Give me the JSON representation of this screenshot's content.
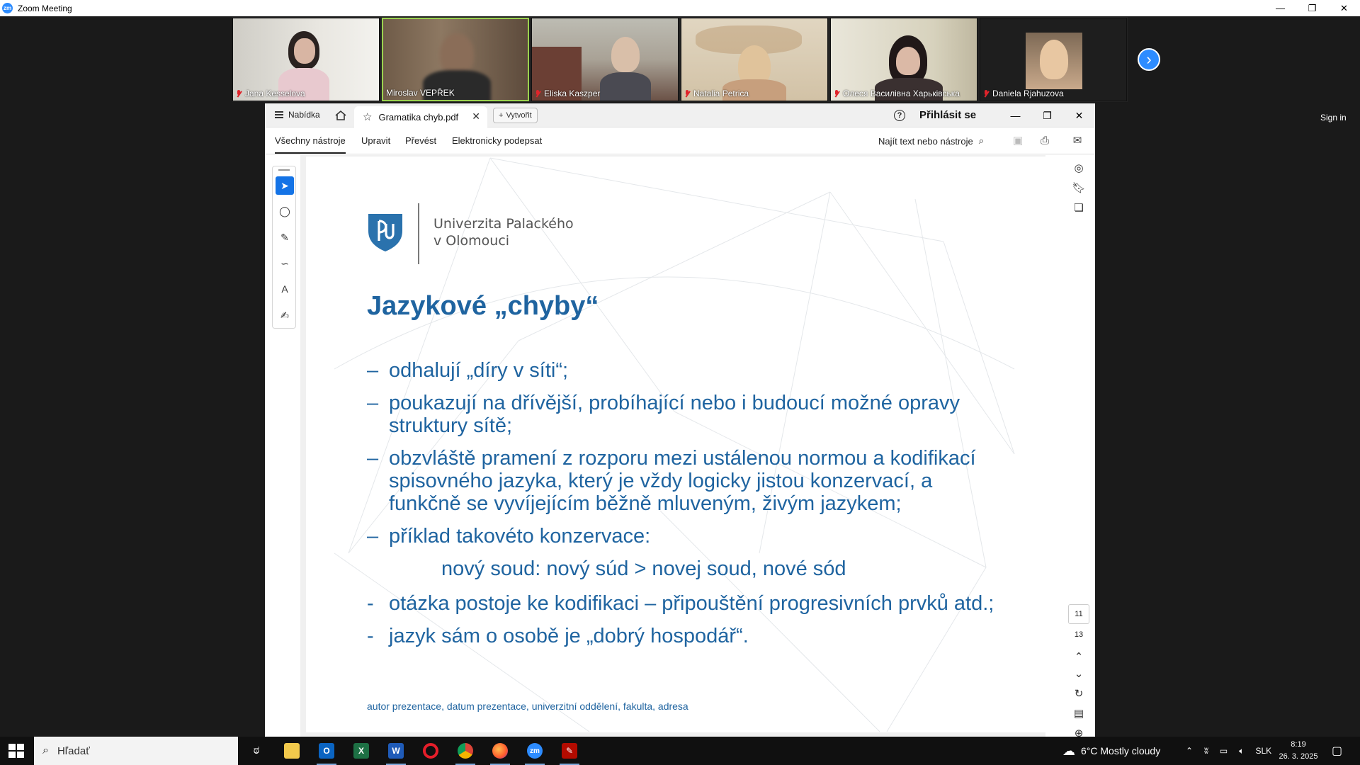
{
  "zoom": {
    "title": "Zoom Meeting",
    "sign_in": "Sign in",
    "participants": [
      {
        "name": "Jana Kesselova",
        "muted": true,
        "bg": "#d9d6cf"
      },
      {
        "name": "Miroslav VEPŘEK",
        "muted": false,
        "bg": "#6c5a48"
      },
      {
        "name": "Eliska Kaszper",
        "muted": true,
        "bg": "#b9b8ad"
      },
      {
        "name": "Natalia Petrica",
        "muted": true,
        "bg": "#d7c8ae"
      },
      {
        "name": "Олеся Василівна Харьківська",
        "muted": true,
        "bg": "#cfcab8"
      },
      {
        "name": "Daniela Rjahuzova",
        "muted": true,
        "bg": "#1e1e1e"
      }
    ]
  },
  "acrobat": {
    "menu_label": "Nabídka",
    "tab_title": "Gramatika chyb.pdf",
    "create_label": "Vytvořit",
    "sign_in_label": "Přihlásit se",
    "toolbar_tabs": [
      "Všechny nástroje",
      "Upravit",
      "Převést",
      "Elektronicky podepsat"
    ],
    "search_tools": "Najít text nebo nástroje",
    "current_page": "11",
    "total_pages": "13"
  },
  "slide": {
    "university_line1": "Univerzita Palackého",
    "university_line2": "v Olomouci",
    "title": "Jazykové „chyby“",
    "bullets": [
      {
        "dash": "–",
        "text": "odhalují „díry v síti“;"
      },
      {
        "dash": "–",
        "text": "poukazují na dřívější, probíhající nebo i budoucí možné opravy struktury sítě;"
      },
      {
        "dash": "–",
        "text": "obzvláště pramení z rozporu mezi ustálenou normou a kodifikací spisovného jazyka, který je vždy logicky jistou konzervací, a funkčně se vyvíjejícím běžně mluveným, živým jazykem;"
      },
      {
        "dash": "–",
        "text": "příklad takovéto konzervace:"
      },
      {
        "dash": "",
        "text": "nový soud: nový súd > novej soud, nové sód",
        "example": true
      },
      {
        "dash": "-",
        "text": "otázka postoje ke kodifikaci – připouštění progresivních prvků atd.;"
      },
      {
        "dash": "-",
        "text": "jazyk sám o osobě je „dobrý hospodář“."
      }
    ],
    "footer": "autor prezentace, datum prezentace, univerzitní oddělení, fakulta, adresa"
  },
  "taskbar": {
    "search_placeholder": "Hľadať",
    "weather": "6°C  Mostly cloudy",
    "language": "SLK",
    "time": "8:19",
    "date": "26. 3. 2025"
  }
}
